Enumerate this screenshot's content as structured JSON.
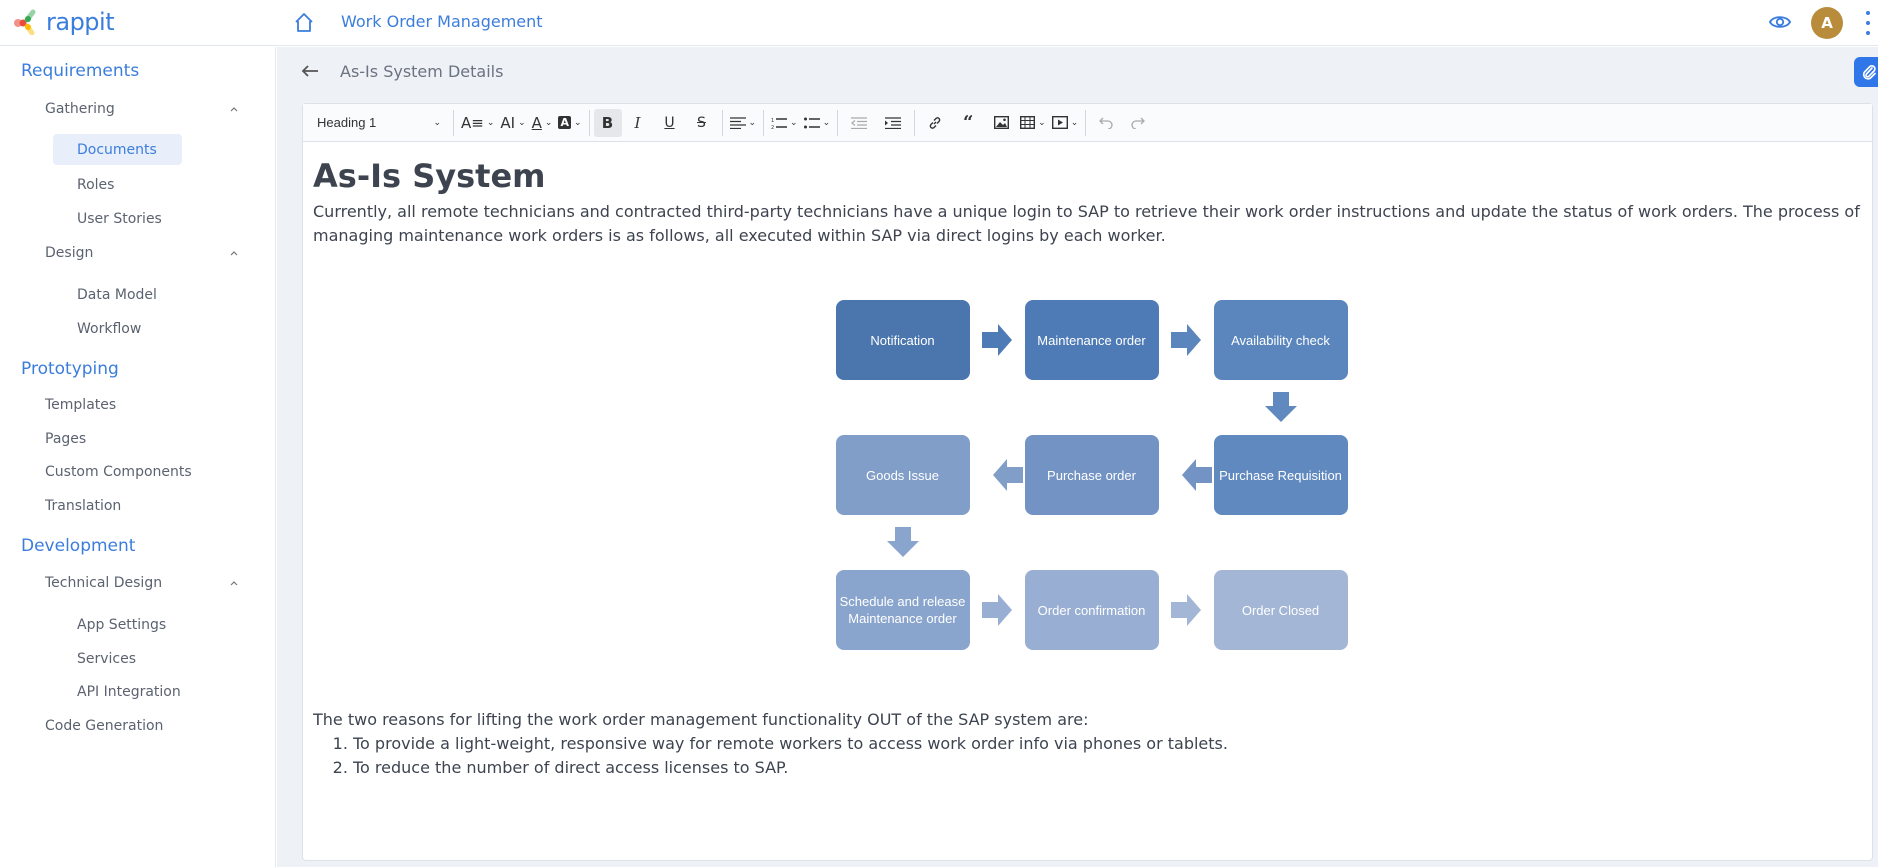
{
  "header": {
    "logo_text": "rappit",
    "app_title": "Work Order Management",
    "avatar_initial": "A"
  },
  "sidebar": {
    "sections": [
      {
        "label": "Requirements",
        "groups": [
          {
            "label": "Gathering",
            "expanded": true,
            "items": [
              "Documents",
              "Roles",
              "User Stories"
            ]
          },
          {
            "label": "Design",
            "expanded": true,
            "items": [
              "Data Model",
              "Workflow"
            ]
          }
        ]
      },
      {
        "label": "Prototyping",
        "items": [
          "Templates",
          "Pages",
          "Custom Components",
          "Translation"
        ]
      },
      {
        "label": "Development",
        "groups": [
          {
            "label": "Technical Design",
            "expanded": true,
            "items": [
              "App Settings",
              "Services",
              "API Integration"
            ]
          }
        ],
        "items": [
          "Code Generation"
        ]
      }
    ],
    "active_item": "Documents"
  },
  "page": {
    "title": "As-Is System Details"
  },
  "toolbar": {
    "heading_select": "Heading 1",
    "buttons": [
      "font-size",
      "text-case",
      "font-color",
      "background-color",
      "bold",
      "italic",
      "underline",
      "strikethrough",
      "align",
      "numbered-list",
      "bulleted-list",
      "outdent",
      "indent",
      "link",
      "blockquote",
      "image",
      "table",
      "media",
      "undo",
      "redo"
    ],
    "bold_active": true
  },
  "document": {
    "heading": "As-Is System",
    "intro": "Currently, all remote technicians and contracted third-party technicians have a unique login to SAP to retrieve their work order instructions and update the status of work orders. The process of managing maintenance work orders is as follows, all executed within SAP via direct logins by each worker.",
    "flow_steps": [
      {
        "label": "Notification",
        "color": "#4a76ad"
      },
      {
        "label": "Maintenance order",
        "color": "#4e7bb5"
      },
      {
        "label": "Availability check",
        "color": "#5a85bd"
      },
      {
        "label": "Purchase Requisition",
        "color": "#6089c0"
      },
      {
        "label": "Purchase order",
        "color": "#7393c4"
      },
      {
        "label": "Goods Issue",
        "color": "#819ec9"
      },
      {
        "label": "Schedule and release Maintenance order",
        "color": "#8aa5cd"
      },
      {
        "label": "Order confirmation",
        "color": "#98aed2"
      },
      {
        "label": "Order Closed",
        "color": "#a3b6d6"
      }
    ],
    "reasons_intro": "The two reasons for lifting the work order management functionality OUT of the SAP system are:",
    "reasons": [
      "To provide a light-weight, responsive way for remote workers to access work order info via phones or tablets.",
      "To reduce the number of direct access licenses to SAP."
    ]
  },
  "colors": {
    "accent": "#3b7ddd",
    "avatar": "#b98c3c",
    "attach_button": "#2f77e8"
  }
}
